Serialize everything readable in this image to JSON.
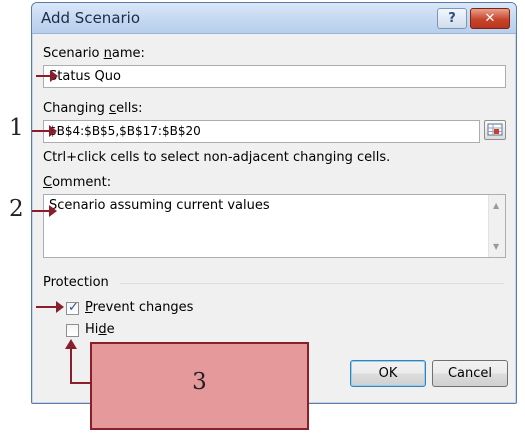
{
  "dialog": {
    "title": "Add Scenario",
    "help_label": "?",
    "close_label": "✕"
  },
  "scenario_name": {
    "label_pre": "Scenario ",
    "label_ul": "n",
    "label_post": "ame:",
    "value": "Status Quo"
  },
  "changing_cells": {
    "label_pre": "Changing ",
    "label_ul": "c",
    "label_post": "ells:",
    "value": "$B$4:$B$5,$B$17:$B$20",
    "hint": "Ctrl+click cells to select non-adjacent changing cells."
  },
  "comment": {
    "label_ul": "C",
    "label_post": "omment:",
    "value": "Scenario assuming current values",
    "scroll_up": "▲",
    "scroll_down": "▼"
  },
  "protection": {
    "group_label": "Protection",
    "prevent_changes": {
      "label_ul": "P",
      "label_post": "revent changes",
      "checked": true,
      "check_glyph": "✓"
    },
    "hide": {
      "label_pre": "Hi",
      "label_ul": "d",
      "label_post": "e",
      "checked": false
    }
  },
  "buttons": {
    "ok": "OK",
    "cancel": "Cancel"
  },
  "callouts": {
    "one": "1",
    "two": "2",
    "three": "3"
  },
  "colors": {
    "callout_fill": "#e6999b",
    "callout_border": "#8a1f2c",
    "title_bar": "#c4d8f1",
    "close_button": "#c8452c"
  }
}
